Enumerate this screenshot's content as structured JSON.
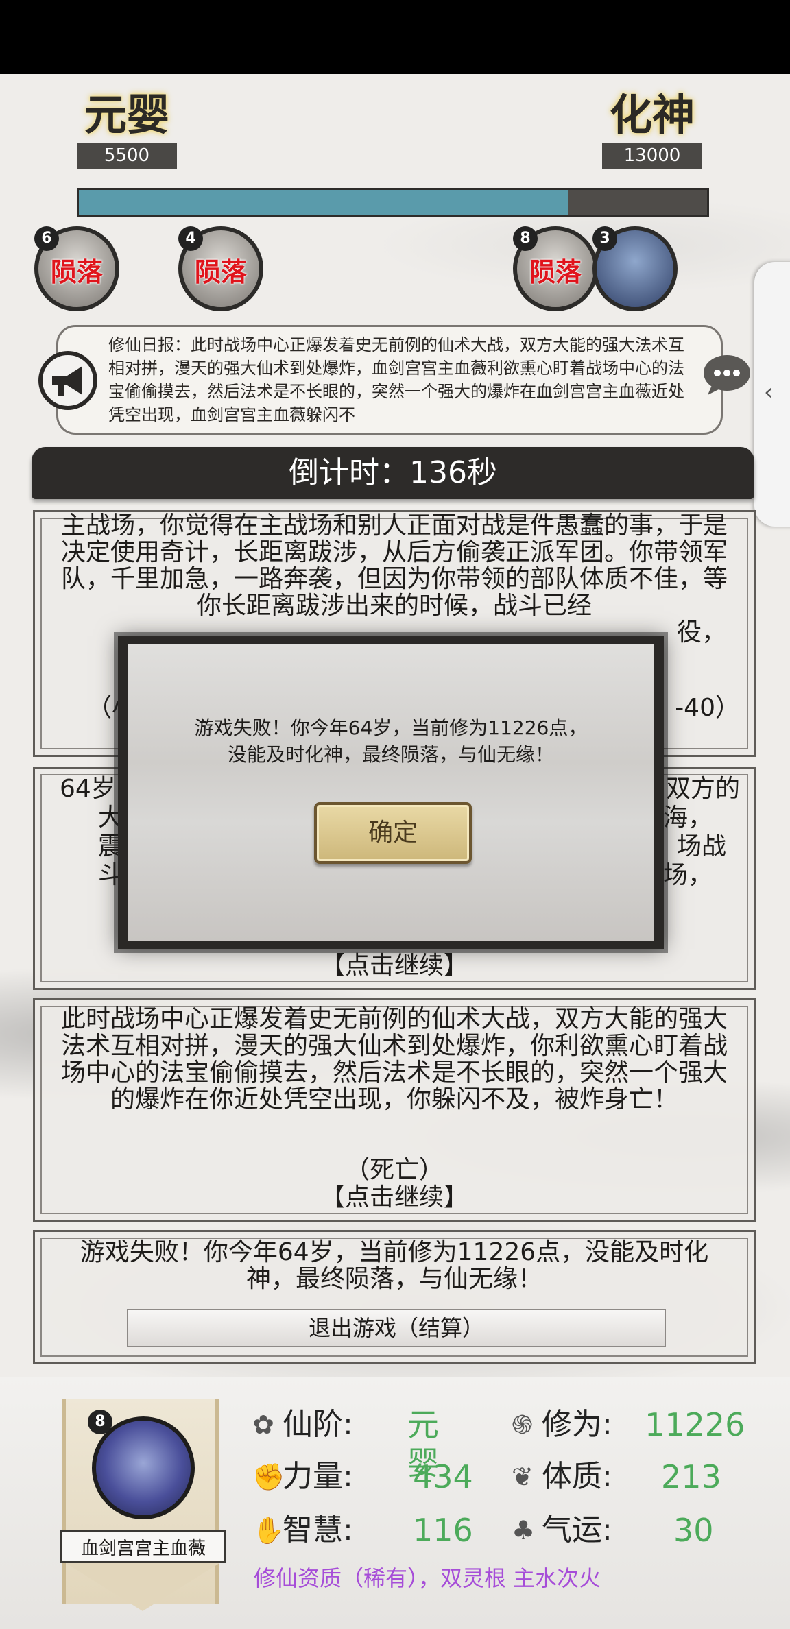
{
  "header": {
    "left_realm": "元婴",
    "left_score": "5500",
    "right_realm": "化神",
    "right_score": "13000",
    "progress_fraction": 0.78
  },
  "avatars": [
    {
      "badge": "6",
      "status": "陨落"
    },
    {
      "badge": "4",
      "status": "陨落"
    },
    {
      "badge": "8",
      "status": "陨落"
    },
    {
      "badge": "3",
      "status": ""
    }
  ],
  "news": {
    "text": "修仙日报：此时战场中心正爆发着史无前例的仙术大战，双方大能的强大法术互相对拼，漫天的强大仙术到处爆炸，血剑宫宫主血薇利欲熏心盯着战场中心的法宝偷偷摸去，然后法术是不长眼的，突然一个强大的爆炸在血剑宫宫主血薇近处凭空出现，血剑宫宫主血薇躲闪不"
  },
  "countdown": "倒计时：136秒",
  "cards": [
    {
      "text": "主战场，你觉得在主战场和别人正面对战是件愚蠢的事，于是决定使用奇计，长距离跋涉，从后方偷袭正派军团。你带领军队，千里加急，一路奔袭，但因为你带领的部队体质不佳，等你长距离跋涉出来的时候，战斗已经",
      "text_tail_right": "役，",
      "note_left": "（小",
      "note_right": "-40）"
    },
    {
      "text_left_1": "64岁",
      "text_right_1": "双方的",
      "text_left_2": "大能",
      "text_right_2": "海，",
      "text_left_3": "震天",
      "text_right_3": "场战",
      "text_left_4": "斗不",
      "text_right_4": "场，",
      "continue": "【点击继续】"
    },
    {
      "text": "此时战场中心正爆发着史无前例的仙术大战，双方大能的强大法术互相对拼，漫天的强大仙术到处爆炸，你利欲熏心盯着战场中心的法宝偷偷摸去，然后法术是不长眼的，突然一个强大的爆炸在你近处凭空出现，你躲闪不及，被炸身亡！",
      "result": "（死亡）",
      "continue": "【点击继续】"
    },
    {
      "text": "游戏失败！你今年64岁，当前修为11226点，没能及时化神，最终陨落，与仙无缘！",
      "exit_button": "退出游戏（结算）"
    }
  ],
  "modal": {
    "message": "游戏失败！你今年64岁，当前修为11226点，没能及时化神，最终陨落，与仙无缘！",
    "confirm": "确定"
  },
  "player": {
    "badge": "8",
    "name": "血剑宫宫主血薇",
    "stats": {
      "realm_label": "仙阶:",
      "realm_value": "元婴",
      "cultivation_label": "修为:",
      "cultivation_value": "11226",
      "strength_label": "力量:",
      "strength_value": "434",
      "constitution_label": "体质:",
      "constitution_value": "213",
      "wisdom_label": "智慧:",
      "wisdom_value": "116",
      "luck_label": "气运:",
      "luck_value": "30"
    },
    "aptitude": "修仙资质（稀有），双灵根 主水次火"
  },
  "colors": {
    "progress": "#5a9bab",
    "dead_text": "#e0141c",
    "stat_value": "#4caa5a",
    "aptitude": "#a64dd8"
  }
}
